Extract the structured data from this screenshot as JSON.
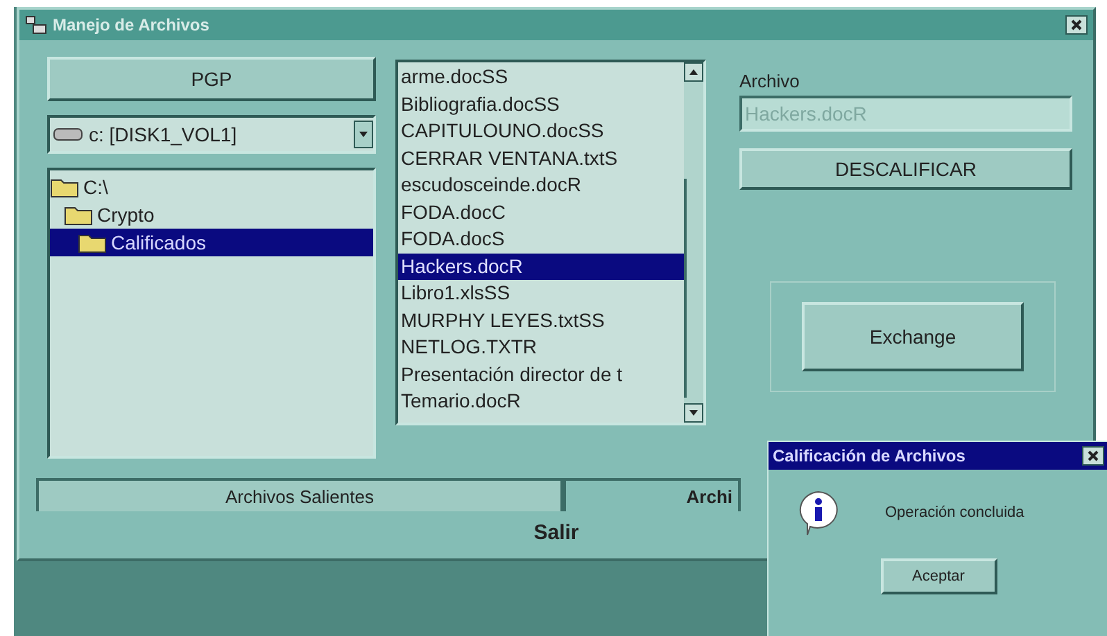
{
  "window": {
    "title": "Manejo de Archivos"
  },
  "pgp_button": "PGP",
  "drive": {
    "value": "c: [DISK1_VOL1]"
  },
  "folders": [
    {
      "label": "C:\\",
      "selected": false,
      "children": [
        {
          "label": "Crypto",
          "selected": false,
          "children": [
            {
              "label": "Calificados",
              "selected": true
            }
          ]
        }
      ]
    }
  ],
  "files": [
    {
      "name": "arme.docSS",
      "selected": false
    },
    {
      "name": "Bibliografia.docSS",
      "selected": false
    },
    {
      "name": "CAPITULOUNO.docSS",
      "selected": false
    },
    {
      "name": "CERRAR VENTANA.txtS",
      "selected": false
    },
    {
      "name": "escudosceinde.docR",
      "selected": false
    },
    {
      "name": "FODA.docC",
      "selected": false
    },
    {
      "name": "FODA.docS",
      "selected": false
    },
    {
      "name": "Hackers.docR",
      "selected": true
    },
    {
      "name": "Libro1.xlsSS",
      "selected": false
    },
    {
      "name": "MURPHY LEYES.txtSS",
      "selected": false
    },
    {
      "name": "NETLOG.TXTR",
      "selected": false
    },
    {
      "name": "Presentación director de t",
      "selected": false
    },
    {
      "name": "Temario.docR",
      "selected": false
    }
  ],
  "archivo": {
    "label": "Archivo",
    "value": "Hackers.docR",
    "disabled": true
  },
  "descalificar_button": "DESCALIFICAR",
  "exchange_button": "Exchange",
  "tabs": [
    {
      "label": "Archivos Salientes",
      "selected": false
    },
    {
      "label": "Archi",
      "selected": true
    }
  ],
  "salir": "Salir",
  "dialog": {
    "title": "Calificación de Archivos",
    "message": "Operación concluida",
    "button": "Aceptar"
  }
}
